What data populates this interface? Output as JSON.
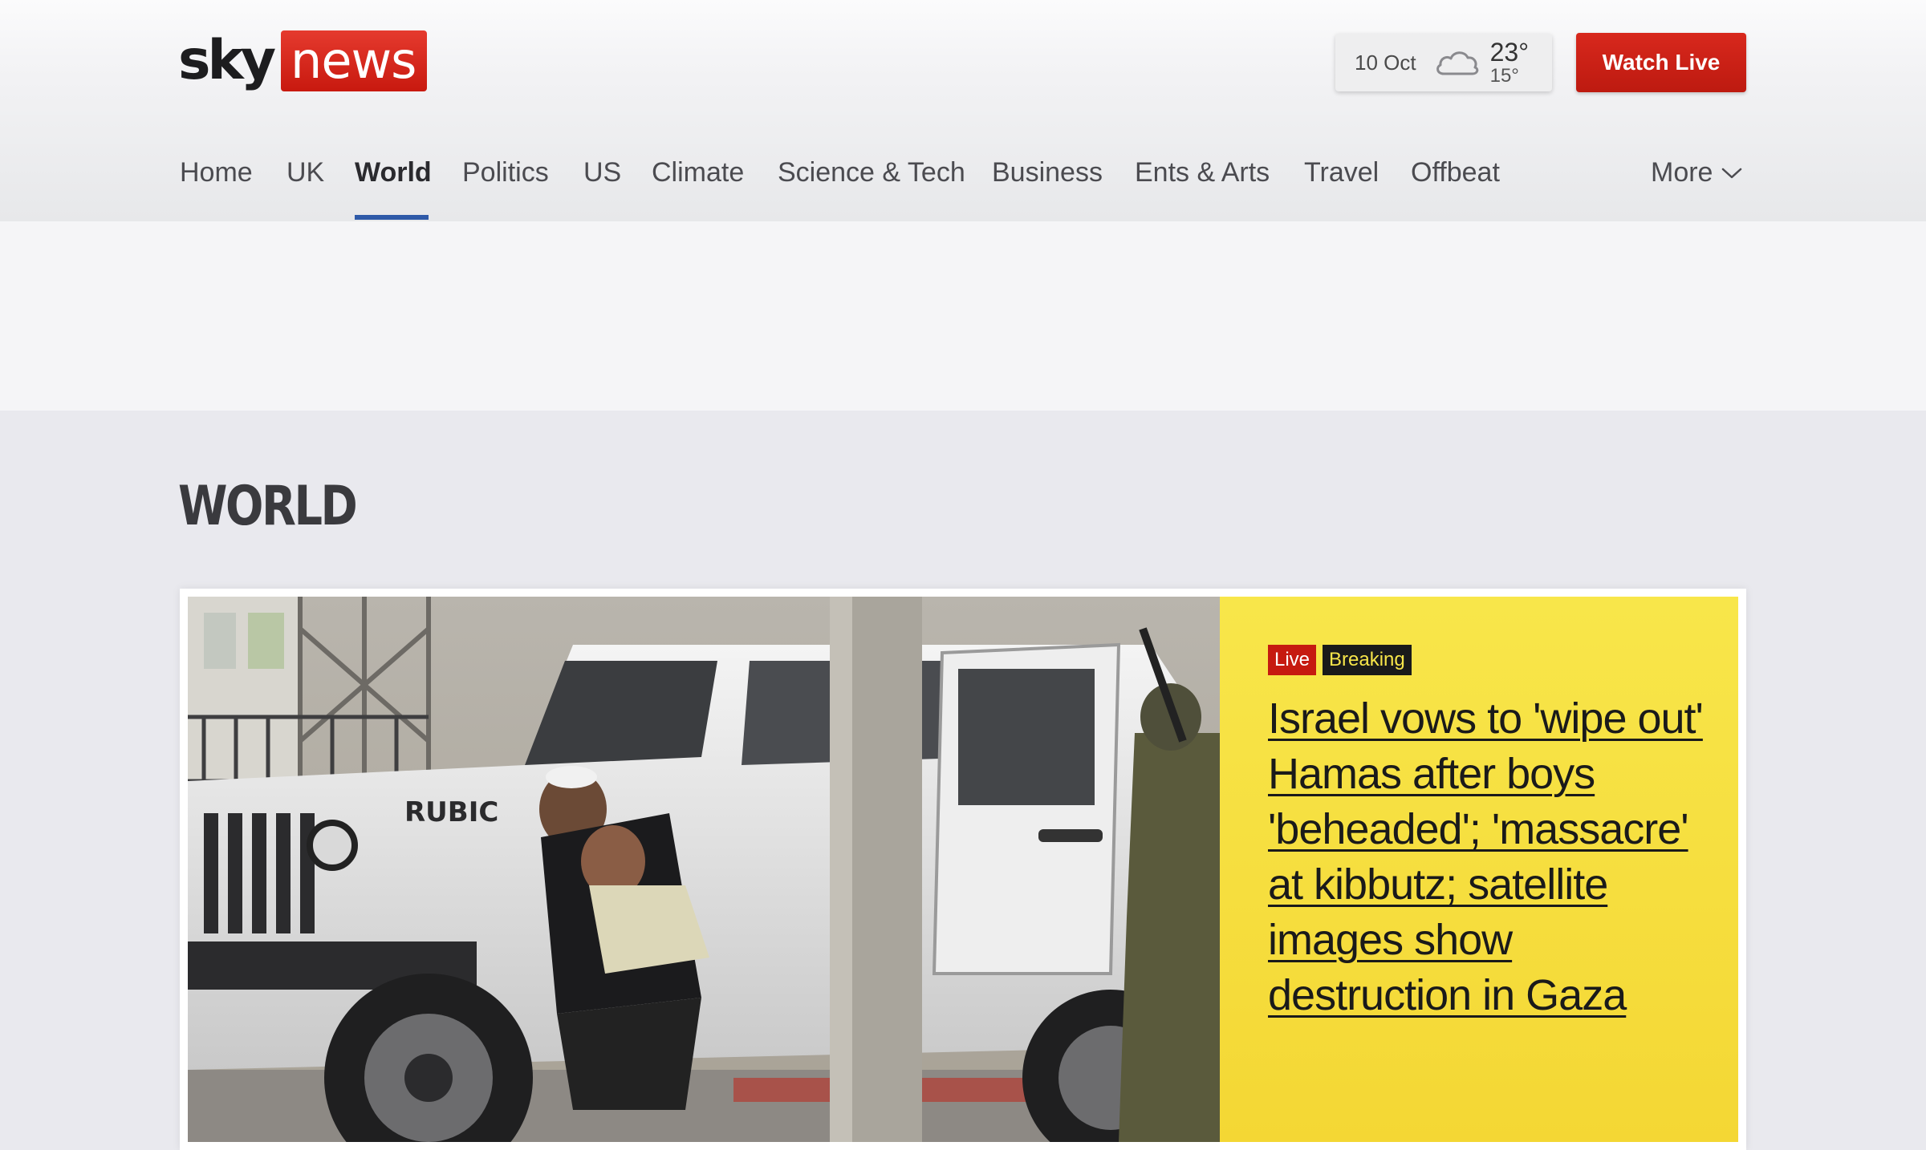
{
  "brand": {
    "logo_sky": "sky",
    "logo_news": "news"
  },
  "weather": {
    "date": "10 Oct",
    "icon": "cloud-icon",
    "high": "23°",
    "low": "15°"
  },
  "header": {
    "watch_live_label": "Watch Live"
  },
  "nav": {
    "items": [
      {
        "label": "Home"
      },
      {
        "label": "UK"
      },
      {
        "label": "World"
      },
      {
        "label": "Politics"
      },
      {
        "label": "US"
      },
      {
        "label": "Climate"
      },
      {
        "label": "Science & Tech"
      },
      {
        "label": "Business"
      },
      {
        "label": "Ents & Arts"
      },
      {
        "label": "Travel"
      },
      {
        "label": "Offbeat"
      }
    ],
    "active": "World",
    "more_label": "More"
  },
  "section": {
    "title": "WORLD"
  },
  "hero": {
    "badge_live": "Live",
    "badge_breaking": "Breaking",
    "headline": "Israel vows to 'wipe out' Hamas after boys 'beheaded'; 'massacre' at kibbutz; satellite images show destruction in Gaza",
    "image_text": "RUBIC"
  },
  "colors": {
    "brand_red": "#c8190f",
    "nav_active_underline": "#2f5aa8",
    "hero_yellow": "#f6dd3c",
    "breaking_bg": "#1a1a1a"
  }
}
